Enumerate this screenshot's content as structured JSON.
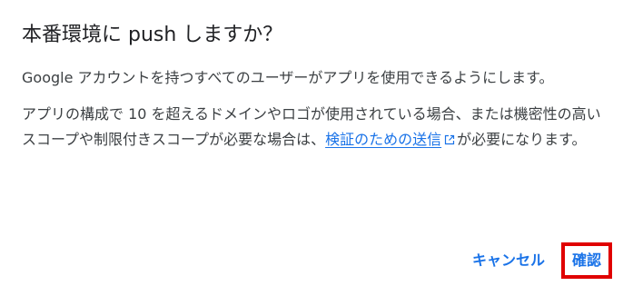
{
  "dialog": {
    "title": "本番環境に push しますか？",
    "paragraph1": "Google アカウントを持つすべてのユーザーがアプリを使用できるようにします。",
    "paragraph2_prefix": "アプリの構成で 10 を超えるドメインやロゴが使用されている場合、または機密性の高いスコープや制限付きスコープが必要な場合は、",
    "paragraph2_link": "検証のための送信",
    "paragraph2_suffix": "が必要になります。",
    "link_icon": "external-link-icon"
  },
  "actions": {
    "cancel_label": "キャンセル",
    "confirm_label": "確認"
  },
  "colors": {
    "accent": "#1a73e8",
    "highlight": "#e00000",
    "title_text": "#202124",
    "body_text": "#3c4043"
  }
}
